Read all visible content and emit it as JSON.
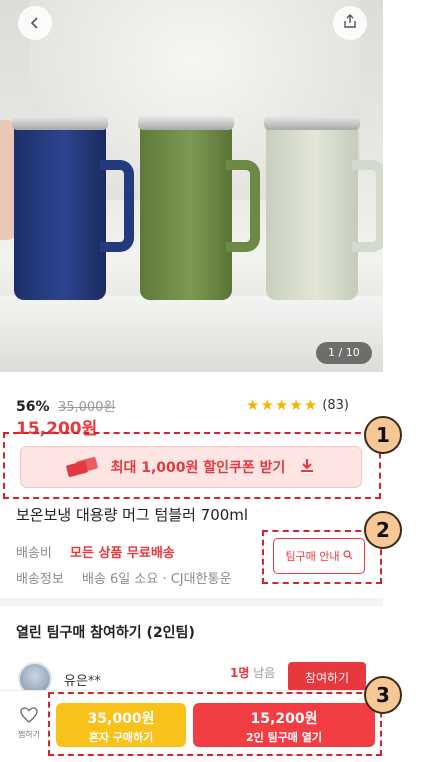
{
  "header": {
    "back_icon": "chevron-left-icon",
    "share_icon": "share-icon"
  },
  "gallery": {
    "counter": "1 / 10"
  },
  "price": {
    "discount": "56%",
    "original": "35,000원",
    "sale": "15,200원"
  },
  "rating": {
    "stars": "★★★★★",
    "count": "(83)"
  },
  "coupon": {
    "label": "최대 1,000원 할인쿠폰 받기",
    "icon": "coupon-icon",
    "download_icon": "download-icon"
  },
  "product": {
    "title": "보온보냉 대용량 머그 텀블러 700ml"
  },
  "shipping": {
    "fee_label": "배송비",
    "fee_value": "모든 상품 무료배송",
    "info_label": "배송정보",
    "info_value": "배송 6일 소요 · CJ대한통운"
  },
  "team_guide": {
    "label": "팀구매 안내",
    "icon": "search-icon"
  },
  "team_section": {
    "title": "열린 팀구매 참여하기 (2인팀)",
    "rows": [
      {
        "name": "유은**",
        "remain_count": "1명",
        "remain_label": " 남음",
        "join_label": "참여하기"
      }
    ]
  },
  "bottom_bar": {
    "like_label": "찜하기",
    "solo": {
      "price": "35,000원",
      "label": "혼자 구매하기"
    },
    "team": {
      "price": "15,200원",
      "label": "2인 팀구매 열기"
    }
  },
  "annotations": [
    "1",
    "2",
    "3"
  ],
  "colors": {
    "accent": "#e8383d",
    "solo_button": "#f8c21b",
    "team_button": "#f23e42",
    "annotation": "#d4232a",
    "badge": "#f7c896"
  }
}
